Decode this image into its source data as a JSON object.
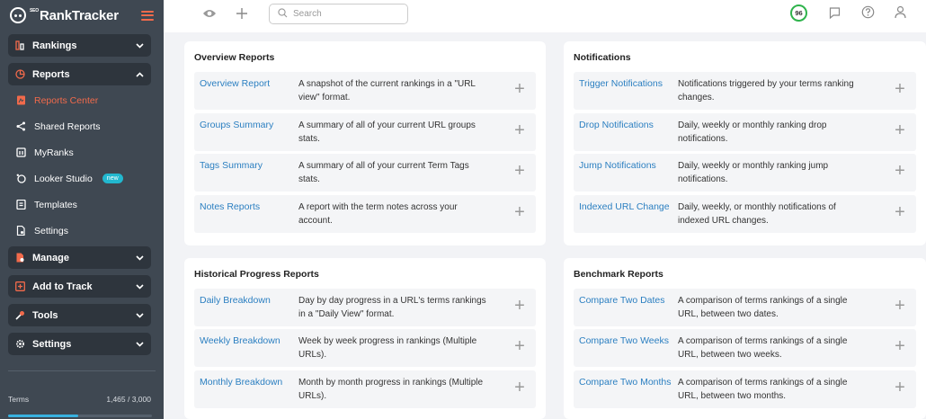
{
  "app": {
    "logo_text": "RankTracker",
    "logo_prefix": "SEO"
  },
  "sidebar": {
    "groups": [
      {
        "label": "Rankings",
        "expanded": false,
        "icon": "rankings-icon"
      },
      {
        "label": "Reports",
        "expanded": true,
        "icon": "reports-icon",
        "items": [
          {
            "label": "Reports Center",
            "active": true,
            "icon": "reports-center-icon"
          },
          {
            "label": "Shared Reports",
            "icon": "share-icon"
          },
          {
            "label": "MyRanks",
            "icon": "myranks-icon"
          },
          {
            "label": "Looker Studio",
            "icon": "looker-icon",
            "badge": "new"
          },
          {
            "label": "Templates",
            "icon": "templates-icon"
          },
          {
            "label": "Settings",
            "icon": "settings-doc-icon"
          }
        ]
      },
      {
        "label": "Manage",
        "expanded": false,
        "icon": "manage-icon"
      },
      {
        "label": "Add to Track",
        "expanded": false,
        "icon": "add-to-track-icon"
      },
      {
        "label": "Tools",
        "expanded": false,
        "icon": "tools-icon"
      },
      {
        "label": "Settings",
        "expanded": false,
        "icon": "settings-gear-icon"
      }
    ],
    "terms": {
      "label": "Terms",
      "count": "1,465 / 3,000",
      "fraction": 0.49
    }
  },
  "topbar": {
    "search_placeholder": "Search",
    "score": "96"
  },
  "cards": {
    "overview": {
      "title": "Overview Reports",
      "rows": [
        {
          "name": "Overview Report",
          "desc": "A snapshot of the current rankings in a \"URL view\" format."
        },
        {
          "name": "Groups Summary",
          "desc": "A summary of all of your current URL groups stats."
        },
        {
          "name": "Tags Summary",
          "desc": "A summary of all of your current Term Tags stats."
        },
        {
          "name": "Notes Reports",
          "desc": "A report with the term notes across your account."
        }
      ]
    },
    "notifications": {
      "title": "Notifications",
      "rows": [
        {
          "name": "Trigger Notifications",
          "desc": "Notifications triggered by your terms ranking changes."
        },
        {
          "name": "Drop Notifications",
          "desc": "Daily, weekly or monthly ranking drop notifications."
        },
        {
          "name": "Jump Notifications",
          "desc": "Daily, weekly or monthly ranking jump notifications."
        },
        {
          "name": "Indexed URL Change",
          "desc": "Daily, weekly, or monthly notifications of indexed URL changes."
        }
      ]
    },
    "historical": {
      "title": "Historical Progress Reports",
      "rows": [
        {
          "name": "Daily Breakdown",
          "desc": "Day by day progress in a URL's terms rankings in a \"Daily View\" format."
        },
        {
          "name": "Weekly Breakdown",
          "desc": "Week by week progress in rankings (Multiple URLs)."
        },
        {
          "name": "Monthly Breakdown",
          "desc": "Month by month progress in rankings (Multiple URLs)."
        }
      ]
    },
    "benchmark": {
      "title": "Benchmark Reports",
      "rows": [
        {
          "name": "Compare Two Dates",
          "desc": "A comparison of terms rankings of a single URL, between two dates."
        },
        {
          "name": "Compare Two Weeks",
          "desc": "A comparison of terms rankings of a single URL, between two weeks."
        },
        {
          "name": "Compare Two Months",
          "desc": "A comparison of terms rankings of a single URL, between two months."
        }
      ]
    }
  },
  "colors": {
    "accent": "#f16a4b",
    "link": "#2b7fc1",
    "sidebar": "#3f4852",
    "score_ring": "#2fb34c"
  }
}
